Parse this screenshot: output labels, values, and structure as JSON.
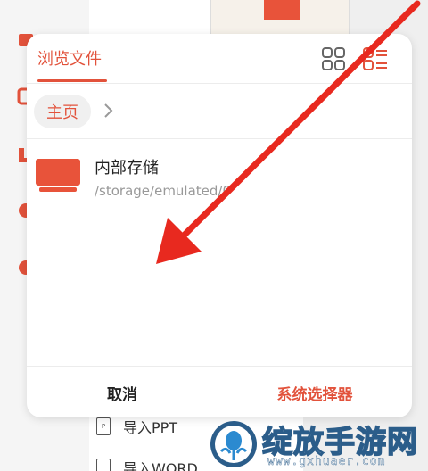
{
  "modal": {
    "tab_label": "浏览文件",
    "breadcrumb": {
      "home_label": "主页"
    },
    "storage": {
      "name": "内部存储",
      "path": "/storage/emulated/0"
    },
    "footer": {
      "cancel_label": "取消",
      "system_picker_label": "系统选择器"
    }
  },
  "background": {
    "rows": [
      {
        "icon_badge": "P",
        "label": "导入PPT"
      },
      {
        "icon_badge": "",
        "label": "导入WORD"
      }
    ]
  },
  "watermark": {
    "title": "绽放手游网",
    "url": "www.gxhuaer.com"
  },
  "colors": {
    "accent": "#e2523b",
    "arrow": "#e8291f"
  },
  "icons": [
    "grid-view-icon",
    "list-view-icon",
    "chevron-right-icon",
    "folder-icon",
    "document-icon"
  ]
}
